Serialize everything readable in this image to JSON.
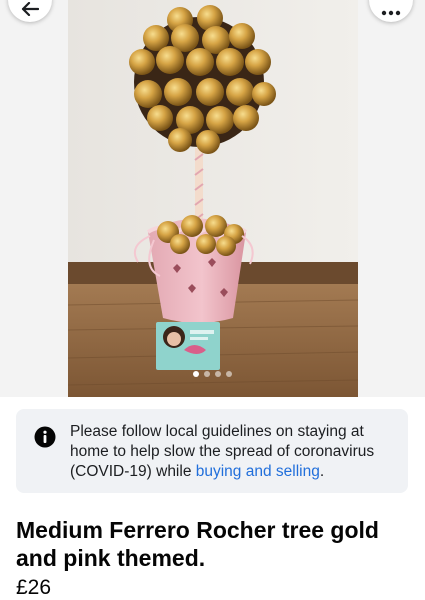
{
  "icons": {
    "back": "back-arrow-icon",
    "more": "more-options-icon",
    "info": "info-icon"
  },
  "gallery": {
    "photo_count": 4,
    "active_index": 0
  },
  "notice": {
    "text_before_link": "Please follow local guidelines on staying at home to help slow the spread of coronavirus (COVID-19) while ",
    "link_text": "buying and selling",
    "text_after_link": "."
  },
  "listing": {
    "title": "Medium Ferrero Rocher tree gold and pink themed.",
    "price": "£26"
  },
  "colors": {
    "link": "#216fdb",
    "notice_background": "#f0f2f5",
    "text": "#050505"
  }
}
